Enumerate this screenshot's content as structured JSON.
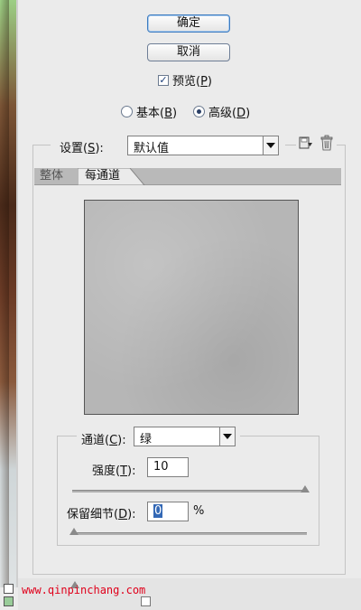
{
  "buttons": {
    "ok": "确定",
    "cancel": "取消"
  },
  "preview": {
    "label": "预览(",
    "key": "P",
    "close": ")",
    "checked": true
  },
  "mode": {
    "basic": {
      "label": "基本(",
      "key": "B",
      "close": ")",
      "selected": false
    },
    "advanced": {
      "label": "高级(",
      "key": "D",
      "close": ")",
      "selected": true
    }
  },
  "settings": {
    "label": "设置(",
    "key": "S",
    "close": "):",
    "value": "默认值"
  },
  "tabs": [
    {
      "label": "整体",
      "active": false
    },
    {
      "label": "每通道",
      "active": true
    }
  ],
  "channel": {
    "label": "通道(",
    "key": "C",
    "close": "):",
    "value": "绿"
  },
  "strength": {
    "label": "强度(",
    "key": "T",
    "close": "):",
    "value": "10",
    "slider_fraction": 1.0
  },
  "preserve": {
    "label": "保留细节(",
    "key": "D",
    "close": "):",
    "value": "0",
    "unit": "%",
    "slider_fraction": 0.0
  },
  "watermark": "www.qinpinchang.com",
  "colors": {
    "accent": "#3d7bbf",
    "watermark": "#e0001b"
  },
  "icons": {
    "save": "save-settings-icon",
    "delete": "trash-icon"
  }
}
